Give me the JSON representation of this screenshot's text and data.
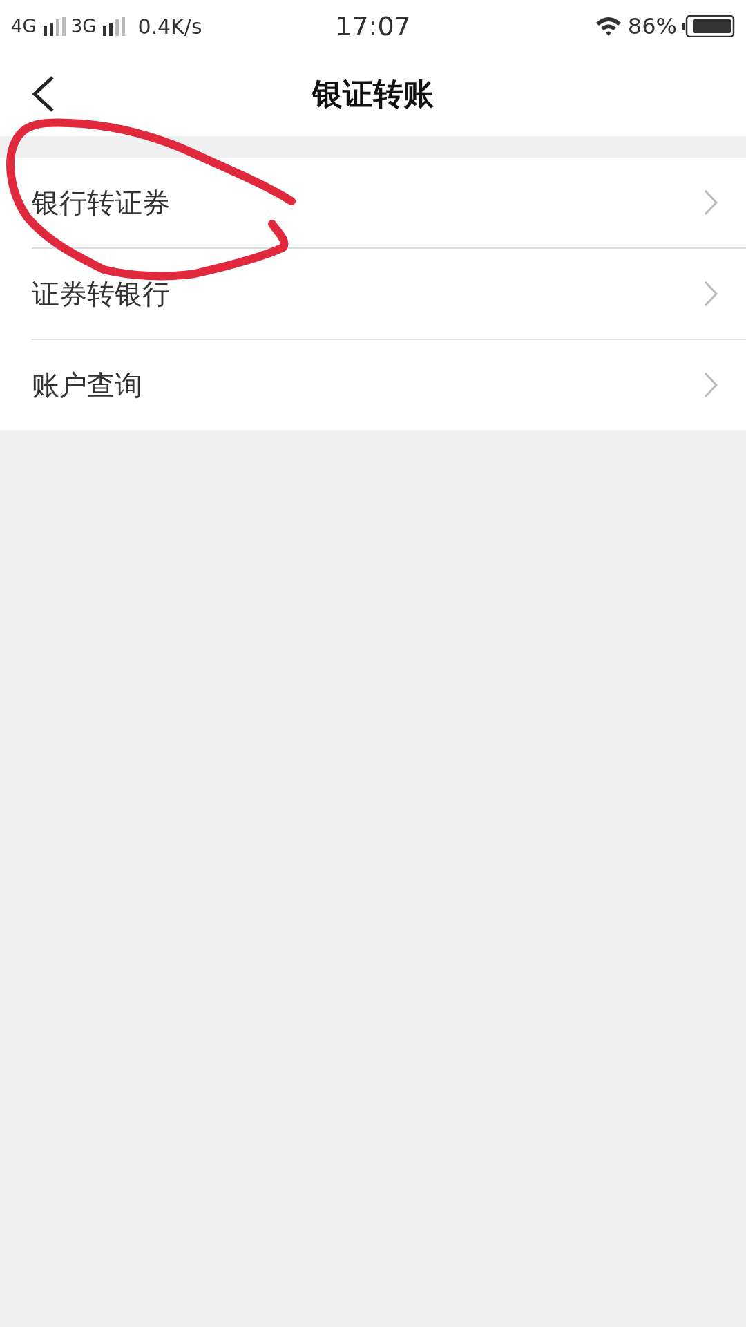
{
  "status_bar": {
    "network_1": "4G",
    "network_2": "3G",
    "speed": "0.4K/s",
    "time": "17:07",
    "battery": "86%"
  },
  "header": {
    "title": "银证转账"
  },
  "menu": [
    {
      "label": "银行转证券"
    },
    {
      "label": "证券转银行"
    },
    {
      "label": "账户查询"
    }
  ]
}
